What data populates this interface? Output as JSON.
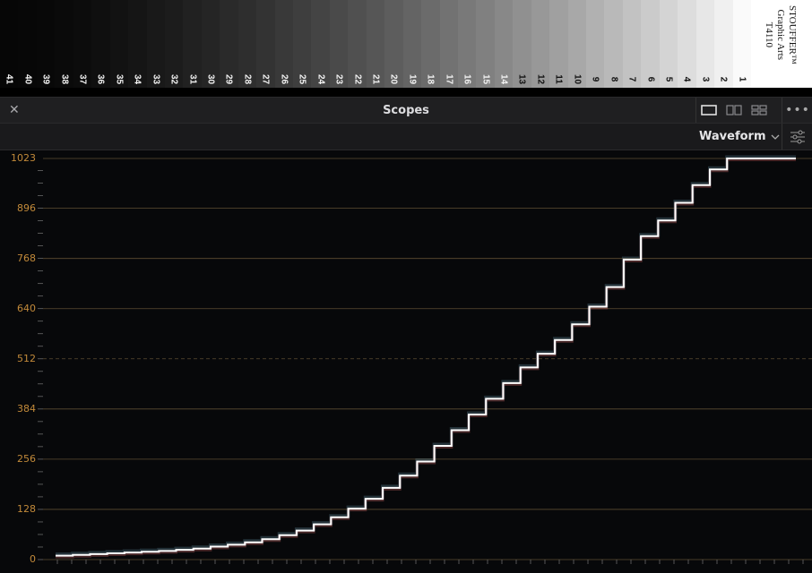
{
  "chart": {
    "patch_numbers": [
      "41",
      "40",
      "39",
      "38",
      "37",
      "36",
      "35",
      "34",
      "33",
      "32",
      "31",
      "30",
      "29",
      "28",
      "27",
      "26",
      "25",
      "24",
      "23",
      "22",
      "21",
      "20",
      "19",
      "18",
      "17",
      "16",
      "15",
      "14",
      "13",
      "12",
      "11",
      "10",
      "9",
      "8",
      "7",
      "6",
      "5",
      "4",
      "3",
      "2",
      "1"
    ],
    "label_lines": [
      "STOUFFER™",
      "Graphic Arts",
      "T4110"
    ]
  },
  "panel": {
    "title": "Scopes",
    "close_icon": "close-icon",
    "layout_icons": [
      "single-view-icon",
      "dual-view-icon",
      "quad-view-icon"
    ],
    "more_icon": "more-options-icon"
  },
  "toolbar": {
    "scope_type": "Waveform",
    "dropdown_icon": "chevron-down-icon",
    "settings_icon": "settings-sliders-icon"
  },
  "chart_data": {
    "type": "line",
    "ylim": [
      0,
      1023
    ],
    "y_ticks": [
      0,
      128,
      256,
      384,
      512,
      640,
      768,
      896,
      1023
    ],
    "midline_dashed": 512,
    "grid": true,
    "accent_color": "#c28a3a",
    "series": [
      {
        "values": [
          10,
          12,
          14,
          16,
          18,
          20,
          22,
          25,
          28,
          33,
          38,
          44,
          52,
          62,
          74,
          90,
          108,
          130,
          155,
          183,
          214,
          250,
          290,
          330,
          370,
          410,
          450,
          490,
          525,
          560,
          600,
          645,
          695,
          765,
          825,
          865,
          910,
          955,
          995,
          1023,
          1023,
          1023,
          1023
        ]
      }
    ]
  }
}
